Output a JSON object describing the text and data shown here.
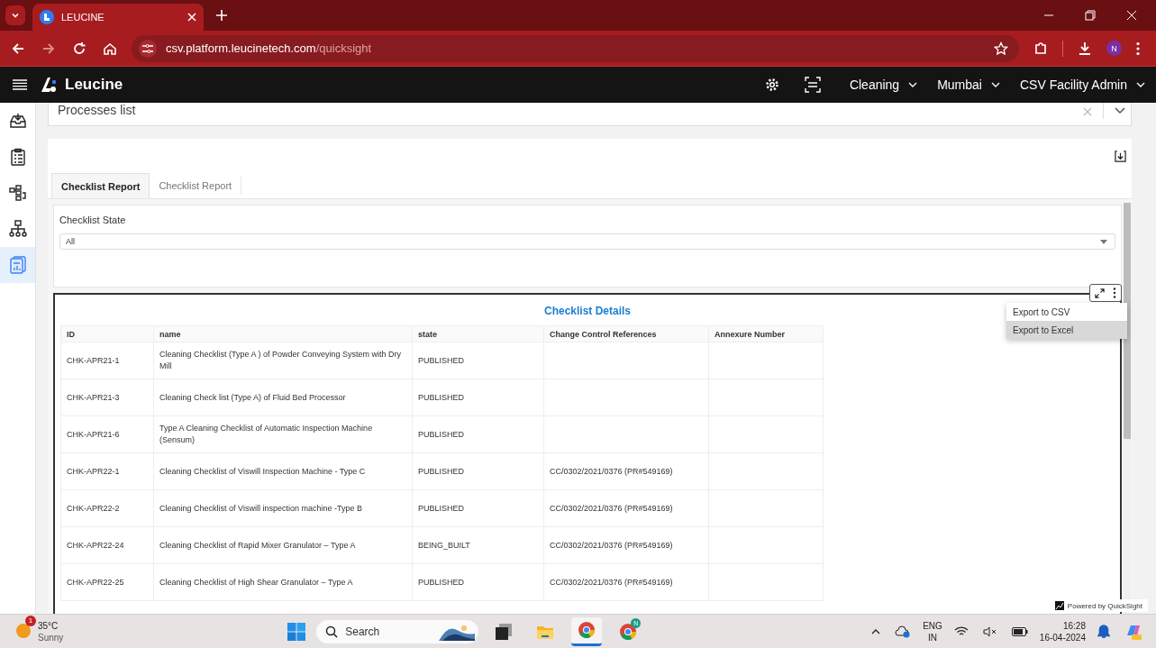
{
  "browser": {
    "tab_title": "LEUCINE",
    "url_host": "csv.platform.leucinetech.com",
    "url_path": "/quicksight",
    "profile_initial": "N"
  },
  "header": {
    "brand": "Leucine",
    "menus": [
      "Cleaning",
      "Mumbai",
      "CSV Facility Admin"
    ]
  },
  "sidebar": {
    "items": [
      {
        "selected": false
      },
      {
        "selected": false
      },
      {
        "selected": false
      },
      {
        "selected": false
      },
      {
        "selected": true
      }
    ]
  },
  "process_select": {
    "value": "Processes list"
  },
  "tabs": [
    {
      "label": "Checklist Report",
      "selected": true
    },
    {
      "label": "Checklist Report",
      "selected": false
    }
  ],
  "filter": {
    "label": "Checklist State",
    "value": "All"
  },
  "visual": {
    "title": "Checklist Details",
    "columns": [
      "ID",
      "name",
      "state",
      "Change Control References",
      "Annexure Number"
    ],
    "rows": [
      [
        "CHK-APR21-1",
        "Cleaning Checklist (Type A ) of Powder Conveying System with Dry Mill",
        "PUBLISHED",
        "",
        ""
      ],
      [
        "CHK-APR21-3",
        "Cleaning Check list (Type A) of Fluid Bed Processor",
        "PUBLISHED",
        "",
        ""
      ],
      [
        "CHK-APR21-6",
        "Type A Cleaning Checklist of Automatic Inspection Machine (Sensum)",
        "PUBLISHED",
        "",
        ""
      ],
      [
        "CHK-APR22-1",
        "Cleaning Checklist of Viswill Inspection Machine - Type C",
        "PUBLISHED",
        "CC/0302/2021/0376 (PR#549169)",
        ""
      ],
      [
        "CHK-APR22-2",
        "Cleaning Checklist of Viswill inspection machine -Type B",
        "PUBLISHED",
        "CC/0302/2021/0376 (PR#549169)",
        ""
      ],
      [
        "CHK-APR22-24",
        "Cleaning Checklist of Rapid Mixer Granulator – Type A",
        "BEING_BUILT",
        "CC/0302/2021/0376 (PR#549169)",
        ""
      ],
      [
        "CHK-APR22-25",
        "Cleaning Checklist of High Shear Granulator – Type A",
        "PUBLISHED",
        "CC/0302/2021/0376 (PR#549169)",
        ""
      ]
    ],
    "menu": [
      {
        "label": "Export to CSV",
        "selected": false
      },
      {
        "label": "Export to Excel",
        "selected": true
      }
    ]
  },
  "footer": "Powered by QuickSight",
  "taskbar": {
    "weather": {
      "badge": "1",
      "temp": "35°C",
      "condition": "Sunny"
    },
    "search": {
      "placeholder": "Search"
    },
    "apps": [
      {
        "kind": "terminal",
        "selected": false
      },
      {
        "kind": "folder",
        "selected": false
      },
      {
        "kind": "chrome",
        "selected": true
      },
      {
        "kind": "chrome-profile",
        "selected": false,
        "badge": "N"
      }
    ],
    "lang": [
      "ENG",
      "IN"
    ],
    "time": "16:28",
    "date": "16-04-2024"
  }
}
